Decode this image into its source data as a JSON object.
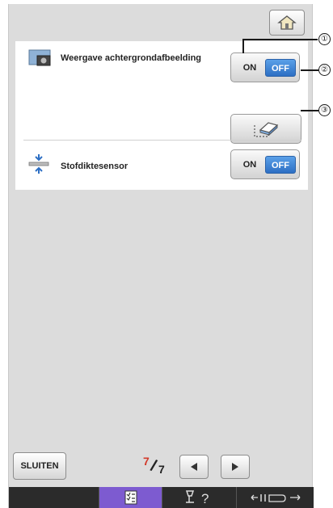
{
  "settings": {
    "background_image": {
      "label": "Weergave achtergrondafbeelding",
      "toggle": {
        "on_label": "ON",
        "off_label": "OFF",
        "selected": "OFF"
      }
    },
    "fabric_thickness_sensor": {
      "label": "Stofdiktesensor",
      "toggle": {
        "on_label": "ON",
        "off_label": "OFF",
        "selected": "OFF"
      }
    }
  },
  "callouts": [
    "①",
    "②",
    "③"
  ],
  "footer": {
    "close_label": "SLUITEN",
    "page_current": "7",
    "page_total": "7"
  },
  "bottom_tabs": [
    {
      "icon": "blank",
      "active": false
    },
    {
      "icon": "settings-list-icon",
      "active": true
    },
    {
      "icon": "help-icon",
      "active": false
    },
    {
      "icon": "presser-foot-icon",
      "active": false
    }
  ],
  "colors": {
    "screen_bg": "#dcdcdc",
    "off_active": "#2d6fc4",
    "page_current": "#d23a2a",
    "active_tab": "#7d5bd0",
    "bottom_bar": "#2b2b2b"
  }
}
